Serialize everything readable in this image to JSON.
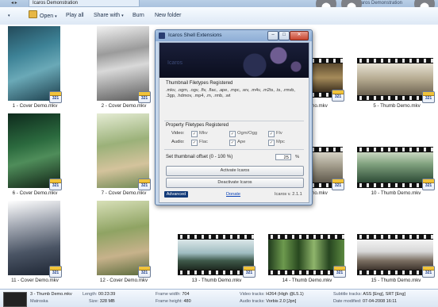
{
  "window": {
    "title": "Icaros Demonstration",
    "title_right": "Icaros Demonstration"
  },
  "toolbar": {
    "items": [
      {
        "label": "Open",
        "icon": "folder-icon",
        "dropdown": true
      },
      {
        "label": "Play all",
        "icon": "play-icon",
        "dropdown": false
      },
      {
        "label": "Share with",
        "icon": "share-icon",
        "dropdown": true
      },
      {
        "label": "Burn",
        "icon": "burn-icon",
        "dropdown": false
      },
      {
        "label": "New folder",
        "icon": "new-folder-icon",
        "dropdown": false
      }
    ]
  },
  "files": [
    {
      "label": "1 - Cover Demo.mkv",
      "kind": "cover"
    },
    {
      "label": "2 - Cover Demo.mkv",
      "kind": "cover"
    },
    {
      "label": "mo.mkv",
      "kind": "thumb"
    },
    {
      "label": "5 - Thumb Demo.mkv",
      "kind": "thumb"
    },
    {
      "label": "6 - Cover Demo.mkv",
      "kind": "cover"
    },
    {
      "label": "7 - Cover Demo.mkv",
      "kind": "cover"
    },
    {
      "label": "mo.mkv",
      "kind": "thumb"
    },
    {
      "label": "10 - Thumb Demo.mkv",
      "kind": "thumb"
    },
    {
      "label": "11 - Cover Demo.mkv",
      "kind": "cover"
    },
    {
      "label": "12 - Cover Demo.mkv",
      "kind": "cover"
    },
    {
      "label": "13 - Thumb Demo.mkv",
      "kind": "thumb"
    },
    {
      "label": "14 - Thumb Demo.mkv",
      "kind": "thumb"
    },
    {
      "label": "15 - Thumb Demo.mkv",
      "kind": "thumb"
    }
  ],
  "badge_text": "321",
  "dialog": {
    "title": "Icaros Shell Extensions",
    "banner_brand": "Icaros",
    "thumbnail_title": "Thumbnail Filetypes Registered",
    "thumbnail_types": ".mkv, .ogm, .ogv, .flv, .flac, .ape, .mpc, .wv, .m4v, .m2ts, .ts, .rmvb, .3gp, .hdmov, .mp4, .m, .rmb, .wt",
    "property_title": "Property Filetypes Registered",
    "video_label": "Video:",
    "audio_label": "Audio:",
    "mkv": "Mkv",
    "ogm_ogg": "Ogm/Ogg",
    "flv": "Flv",
    "flac": "Flac",
    "ape": "Ape",
    "mpc": "Mpc",
    "offset_label": "Set thumbnail offset (0 - 100 %)",
    "offset_value": "25",
    "percent": "%",
    "activate": "Activate Icaros",
    "deactivate": "Deactivate Icaros",
    "advanced": "Advanced",
    "donate": "Donate",
    "version": "Icaros v. 2.1.1"
  },
  "details": {
    "name": "3 - Thumb Demo.mkv",
    "type": "Matroska",
    "length_label": "Length:",
    "length": "00:23:39",
    "size_label": "Size:",
    "size": "328 MB",
    "fw_label": "Frame width:",
    "fw": "704",
    "fh_label": "Frame height:",
    "fh": "480",
    "vt_label": "Video tracks:",
    "vt": "H264 (High @L5.1)",
    "at_label": "Audio tracks:",
    "at": "Vorbis 2.0 [Jpn]",
    "st_label": "Subtitle tracks:",
    "st": "ASS [Eng], SRT [Eng]",
    "dm_label": "Date modified:",
    "dm": "07-04-2008 16:11"
  },
  "colors": {
    "accent": "#123a78",
    "frame": "#c5d6ea",
    "toolbar": "#dde8f5"
  }
}
